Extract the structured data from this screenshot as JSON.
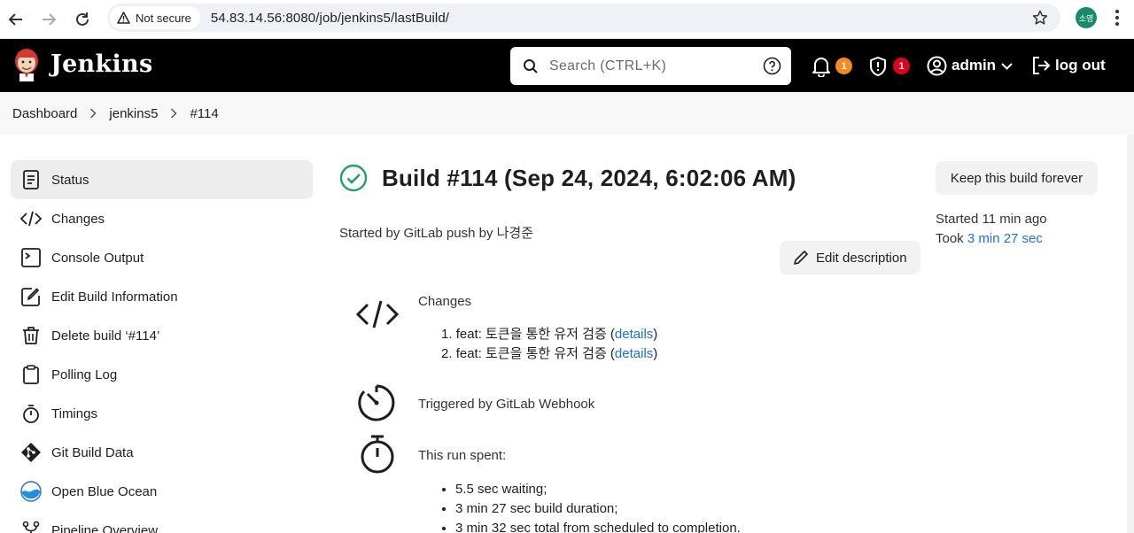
{
  "browser": {
    "security_label": "Not secure",
    "url": "54.83.14.56:8080/job/jenkins5/lastBuild/",
    "profile_initials": "소영"
  },
  "header": {
    "brand": "Jenkins",
    "search_placeholder": "Search (CTRL+K)",
    "notifications_count": "1",
    "security_count": "1",
    "user": "admin",
    "logout": "log out",
    "colors": {
      "background": "#000000",
      "notify_badge": "#f58a1f",
      "security_badge": "#e0001a"
    }
  },
  "breadcrumb": [
    "Dashboard",
    "jenkins5",
    "#114"
  ],
  "sidebar": {
    "items": [
      {
        "label": "Status",
        "icon": "document-icon",
        "active": true
      },
      {
        "label": "Changes",
        "icon": "code-icon"
      },
      {
        "label": "Console Output",
        "icon": "terminal-icon"
      },
      {
        "label": "Edit Build Information",
        "icon": "edit-note-icon"
      },
      {
        "label": "Delete build ‘#114’",
        "icon": "trash-icon"
      },
      {
        "label": "Polling Log",
        "icon": "clipboard-icon"
      },
      {
        "label": "Timings",
        "icon": "stopwatch-icon"
      },
      {
        "label": "Git Build Data",
        "icon": "git-icon"
      },
      {
        "label": "Open Blue Ocean",
        "icon": "blue-ocean-icon"
      },
      {
        "label": "Pipeline Overview",
        "icon": "pipeline-icon"
      }
    ]
  },
  "build": {
    "title": "Build #114 (Sep 24, 2024, 6:02:06 AM)",
    "status": "success",
    "started_by": "Started by GitLab push by 나경준",
    "edit_description": "Edit description",
    "changes": {
      "heading": "Changes",
      "items": [
        {
          "num": "1.",
          "text": "feat: 토큰을 통한 유저 검증 (",
          "link": "details",
          "close": ")"
        },
        {
          "num": "2.",
          "text": "feat: 토큰을 통한 유저 검증 (",
          "link": "details",
          "close": ")"
        }
      ]
    },
    "trigger": "Triggered by GitLab Webhook",
    "run_spent": {
      "heading": "This run spent:",
      "items": [
        "5.5 sec waiting;",
        "3 min 27 sec build duration;",
        "3 min 32 sec total from scheduled to completion."
      ]
    }
  },
  "side_meta": {
    "keep_forever": "Keep this build forever",
    "started_label": "Started",
    "started_value": "11 min ago",
    "took_label": "Took",
    "took_value": "3 min 27 sec"
  }
}
